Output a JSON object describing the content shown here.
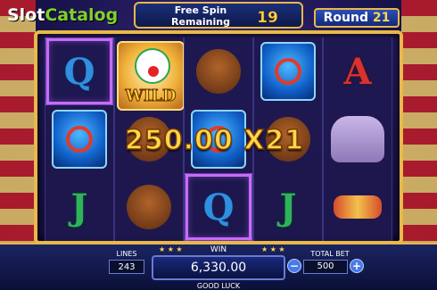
{
  "logo": {
    "part1": "Slot",
    "part2": "Catalog"
  },
  "free_spin": {
    "label_line1": "Free Spin",
    "label_line2": "Remaining",
    "count": "19"
  },
  "round": {
    "label": "Round",
    "number": "21"
  },
  "reels": [
    [
      "Q",
      "ring-acrobat",
      "J"
    ],
    [
      "wild-clown",
      "bear",
      "bear"
    ],
    [
      "bear",
      "ring-acrobat",
      "Q"
    ],
    [
      "ring-acrobat",
      "bear",
      "J"
    ],
    [
      "A",
      "elephant",
      "elephant"
    ]
  ],
  "wild_label": "WILD",
  "win_overlay": "250.00 X21",
  "bottom": {
    "lines_label": "LINES",
    "lines_value": "243",
    "win_label": "WIN",
    "win_value": "6,330.00",
    "totalbet_label": "TOTAL BET",
    "bet_value": "500",
    "minus": "−",
    "plus": "+",
    "status": "GOOD LUCK",
    "stars": "★ ★ ★"
  }
}
